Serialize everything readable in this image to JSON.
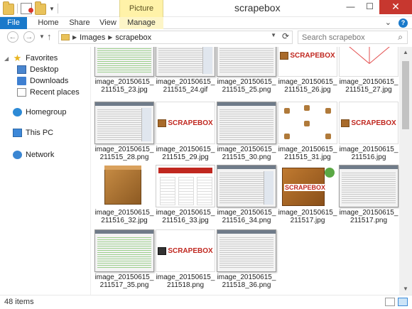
{
  "window": {
    "title": "scrapebox",
    "context_tab_group": "Picture Tools",
    "minimize": "—",
    "maximize": "☐",
    "close": "✕"
  },
  "ribbon": {
    "tabs": [
      "File",
      "Home",
      "Share",
      "View",
      "Manage"
    ],
    "expand_chevron": "⌄",
    "help": "?"
  },
  "address": {
    "breadcrumbs": [
      "Images",
      "scrapebox"
    ],
    "search_placeholder": "Search scrapebox"
  },
  "nav": {
    "favorites": "Favorites",
    "desktop": "Desktop",
    "downloads": "Downloads",
    "recent": "Recent places",
    "homegroup": "Homegroup",
    "this_pc": "This PC",
    "network": "Network"
  },
  "files": [
    {
      "line1": "image_20150615_",
      "line2": "211515_23.jpg"
    },
    {
      "line1": "image_20150615_",
      "line2": "211515_24.gif"
    },
    {
      "line1": "image_20150615_",
      "line2": "211515_25.png"
    },
    {
      "line1": "image_20150615_",
      "line2": "211515_26.jpg"
    },
    {
      "line1": "image_20150615_",
      "line2": "211515_27.jpg"
    },
    {
      "line1": "image_20150615_",
      "line2": "211515_28.png"
    },
    {
      "line1": "image_20150615_",
      "line2": "211515_29.jpg"
    },
    {
      "line1": "image_20150615_",
      "line2": "211515_30.png"
    },
    {
      "line1": "image_20150615_",
      "line2": "211515_31.jpg"
    },
    {
      "line1": "image_20150615_",
      "line2": "211516.jpg"
    },
    {
      "line1": "image_20150615_",
      "line2": "211516_32.jpg"
    },
    {
      "line1": "image_20150615_",
      "line2": "211516_33.jpg"
    },
    {
      "line1": "image_20150615_",
      "line2": "211516_34.png"
    },
    {
      "line1": "image_20150615_",
      "line2": "211517.jpg"
    },
    {
      "line1": "image_20150615_",
      "line2": "211517.png"
    },
    {
      "line1": "image_20150615_",
      "line2": "211517_35.png"
    },
    {
      "line1": "image_20150615_",
      "line2": "211518.png"
    },
    {
      "line1": "image_20150615_",
      "line2": "211518_36.png"
    }
  ],
  "thumb_logo_text": "SCRAPEBOX",
  "status": {
    "item_count": "48 items"
  },
  "colors": {
    "file_tab": "#1979ca",
    "close_button": "#c7372f",
    "context_tab": "#fff2a8"
  }
}
